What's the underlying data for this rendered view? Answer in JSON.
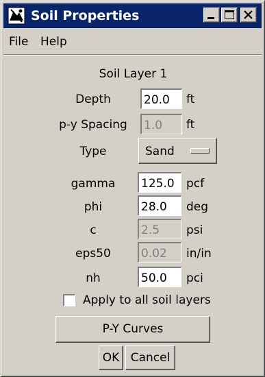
{
  "window": {
    "title": "Soil Properties",
    "title_bar_color": "#0a246a",
    "face_color": "#d4d0c8",
    "controls": {
      "minimize_icon": "minimize-icon",
      "maximize_icon": "maximize-icon",
      "close_icon": "close-icon"
    }
  },
  "menu": {
    "items": [
      {
        "label": "File"
      },
      {
        "label": "Help"
      }
    ]
  },
  "form": {
    "heading": "Soil Layer 1",
    "depth": {
      "label": "Depth",
      "value": "20.0",
      "unit": "ft"
    },
    "py_spacing": {
      "label": "p-y Spacing",
      "value": "1.0",
      "unit": "ft",
      "enabled": false
    },
    "type": {
      "label": "Type",
      "value": "Sand"
    },
    "gamma": {
      "label": "gamma",
      "value": "125.0",
      "unit": "pcf"
    },
    "phi": {
      "label": "phi",
      "value": "28.0",
      "unit": "deg"
    },
    "c": {
      "label": "c",
      "value": "2.5",
      "unit": "psi",
      "enabled": false
    },
    "eps50": {
      "label": "eps50",
      "value": "0.02",
      "unit": "in/in",
      "enabled": false
    },
    "nh": {
      "label": "nh",
      "value": "50.0",
      "unit": "pci"
    },
    "apply_all": {
      "label": "Apply to all soil layers",
      "checked": false
    }
  },
  "buttons": {
    "py_curves": "P-Y Curves",
    "ok": "OK",
    "cancel": "Cancel"
  }
}
